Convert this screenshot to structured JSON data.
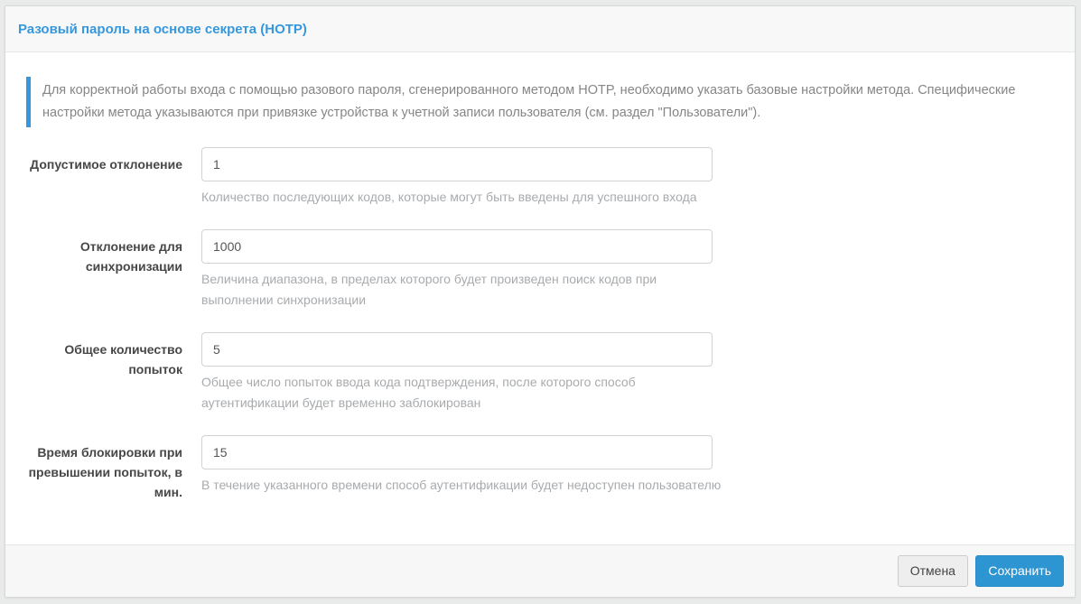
{
  "panel": {
    "title": "Разовый пароль на основе секрета (HOTP)"
  },
  "info": {
    "text": "Для корректной работы входа с помощью разового пароля, сгенерированного методом HOTP, необходимо указать базовые настройки метода. Специфические настройки метода указываются при привязке устройства к учетной записи пользователя (см. раздел \"Пользователи\")."
  },
  "form": {
    "fields": [
      {
        "label": "Допустимое отклонение",
        "value": "1",
        "help": "Количество последующих кодов, которые могут быть введены для успешного входа"
      },
      {
        "label": "Отклонение для синхронизации",
        "value": "1000",
        "help": "Величина диапазона, в пределах которого будет произведен поиск кодов при выполнении синхронизации"
      },
      {
        "label": "Общее количество попыток",
        "value": "5",
        "help": "Общее число попыток ввода кода подтверждения, после которого способ аутентификации будет временно заблокирован"
      },
      {
        "label": "Время блокировки при превышении попыток, в мин.",
        "value": "15",
        "help": "В течение указанного времени способ аутентификации будет недоступен пользователю"
      }
    ]
  },
  "footer": {
    "cancel_label": "Отмена",
    "save_label": "Сохранить"
  },
  "colors": {
    "accent_blue": "#3598dc",
    "save_button": "#2e95d3"
  }
}
